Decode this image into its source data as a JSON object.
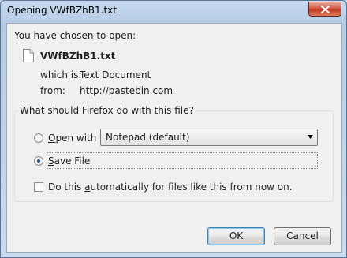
{
  "window": {
    "title": "Opening VWfBZhB1.txt"
  },
  "intro": "You have chosen to open:",
  "file": {
    "name": "VWfBZhB1.txt",
    "which_is_label": "which is:",
    "which_is_value": "Text Document",
    "from_label": "from:",
    "from_value": "http://pastebin.com"
  },
  "group": {
    "legend": "What should Firefox do with this file?",
    "open_with": {
      "prefix": "",
      "accel": "O",
      "rest": "pen with",
      "selected": false
    },
    "app_select": {
      "value": "Notepad (default)"
    },
    "save_file": {
      "accel": "S",
      "rest": "ave File",
      "selected": true
    },
    "auto": {
      "before": "Do this ",
      "accel": "a",
      "after": "utomatically for files like this from now on.",
      "checked": false
    }
  },
  "buttons": {
    "ok": "OK",
    "cancel": "Cancel"
  },
  "colors": {
    "titlebar": "#bfd3ea",
    "close_button": "#c2391f",
    "client_bg": "#f0f0f0"
  }
}
